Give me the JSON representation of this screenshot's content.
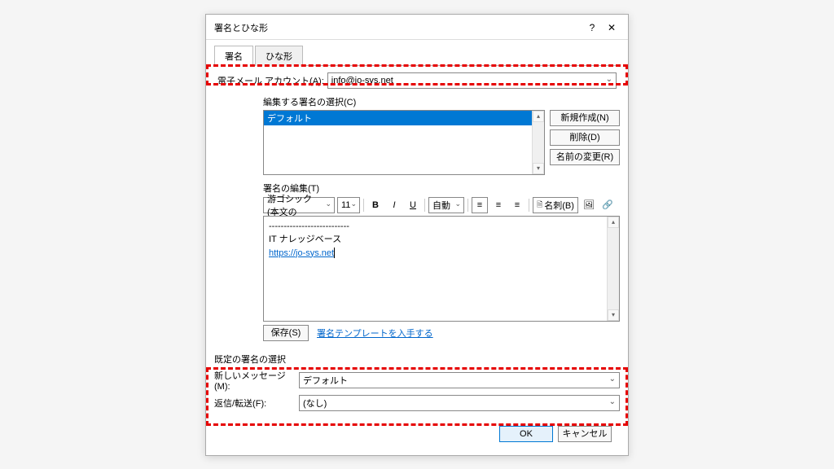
{
  "window": {
    "title": "署名とひな形",
    "help": "?",
    "close": "✕"
  },
  "tabs": {
    "signature": "署名",
    "stationery": "ひな形"
  },
  "account": {
    "label": "電子メール アカウント(A):",
    "value": "info@jo-sys.net"
  },
  "select_signature": {
    "label": "編集する署名の選択(C)",
    "items": [
      "デフォルト"
    ]
  },
  "side_buttons": {
    "new": "新規作成(N)",
    "delete": "削除(D)",
    "rename": "名前の変更(R)"
  },
  "edit": {
    "label": "署名の編集(T)",
    "font": "游ゴシック (本文の",
    "size": "11",
    "auto": "自動",
    "card_label": "名刺(B)",
    "body_divider": "---------------------------",
    "body_line2": "IT ナレッジベース",
    "body_link": "https://jo-sys.net"
  },
  "save_row": {
    "save": "保存(S)",
    "template_link": "署名テンプレートを入手する"
  },
  "defaults": {
    "title": "既定の署名の選択",
    "new_msg_label": "新しいメッセージ(M):",
    "new_msg_value": "デフォルト",
    "reply_label": "返信/転送(F):",
    "reply_value": "(なし)"
  },
  "dialog_buttons": {
    "ok": "OK",
    "cancel": "キャンセル"
  }
}
